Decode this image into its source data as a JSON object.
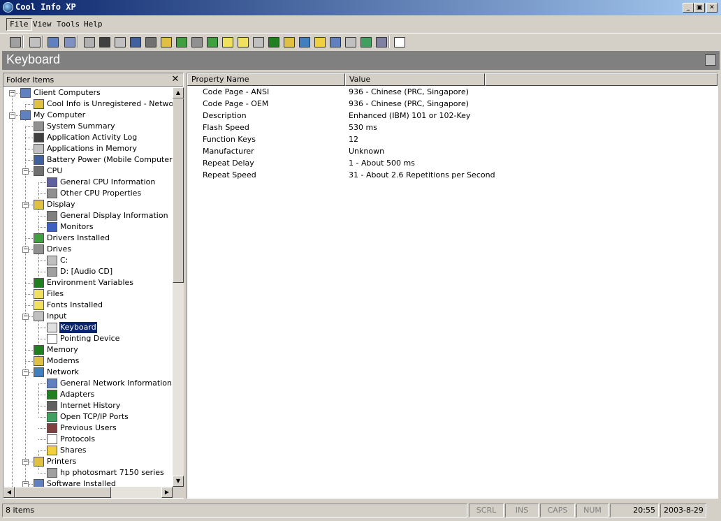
{
  "window": {
    "title": "Cool Info XP",
    "minimize": "_",
    "maximize": "▣",
    "close": "✕"
  },
  "menu": [
    {
      "label": "File"
    },
    {
      "label": "View"
    },
    {
      "label": "Tools"
    },
    {
      "label": "Help"
    }
  ],
  "toolbar": {
    "buttons": [
      {
        "icon": "printer-icon",
        "color": "#a0a0a0"
      },
      {
        "icon": "network-connect-icon",
        "color": "#c0c0c0"
      },
      {
        "icon": "properties-icon",
        "color": "#6080c0"
      },
      {
        "icon": "refresh-icon",
        "color": "#8090c0"
      },
      {
        "icon": "computer-icon",
        "color": "#b0b0b0"
      },
      {
        "icon": "memory-icon",
        "color": "#404040"
      },
      {
        "icon": "application-log-icon",
        "color": "#c0c0c0"
      },
      {
        "icon": "battery-icon",
        "color": "#4060a0"
      },
      {
        "icon": "cpu-icon",
        "color": "#707070"
      },
      {
        "icon": "display-icon",
        "color": "#e0c040"
      },
      {
        "icon": "drivers-icon",
        "color": "#40a040"
      },
      {
        "icon": "drives-icon",
        "color": "#909090"
      },
      {
        "icon": "environment-icon",
        "color": "#40a040"
      },
      {
        "icon": "files-icon",
        "color": "#f0e060"
      },
      {
        "icon": "fonts-icon",
        "color": "#f0e060"
      },
      {
        "icon": "keyboard-icon",
        "color": "#c0c0c0"
      },
      {
        "icon": "memory-chip-icon",
        "color": "#208020"
      },
      {
        "icon": "modem-icon",
        "color": "#e0c040"
      },
      {
        "icon": "network-icon",
        "color": "#4080c0"
      },
      {
        "icon": "folder-icon",
        "color": "#f0d040"
      },
      {
        "icon": "software-icon",
        "color": "#6080c0"
      },
      {
        "icon": "sound-icon",
        "color": "#c0c0c0"
      },
      {
        "icon": "tools-icon",
        "color": "#40a060"
      },
      {
        "icon": "export-icon",
        "color": "#8080a0"
      },
      {
        "icon": "help-icon",
        "color": "#ffffff"
      }
    ]
  },
  "header": {
    "title": "Keyboard"
  },
  "left": {
    "header": "Folder Items",
    "close": "✕",
    "tree": [
      {
        "label": "Client Computers",
        "level": 0,
        "exp": "minus",
        "icon": "client-computers-icon",
        "color": "#6080c0"
      },
      {
        "label": "Cool Info is Unregistered - Network V",
        "level": 1,
        "exp": "",
        "icon": "unregistered-icon",
        "color": "#e0c040"
      },
      {
        "label": "My Computer",
        "level": 0,
        "exp": "minus",
        "icon": "my-computer-icon",
        "color": "#6080c0"
      },
      {
        "label": "System Summary",
        "level": 1,
        "exp": "",
        "icon": "system-summary-icon",
        "color": "#909090"
      },
      {
        "label": "Application Activity Log",
        "level": 1,
        "exp": "",
        "icon": "activity-log-icon",
        "color": "#404040"
      },
      {
        "label": "Applications in Memory",
        "level": 1,
        "exp": "",
        "icon": "applications-icon",
        "color": "#c0c0c0"
      },
      {
        "label": "Battery Power (Mobile Computers)",
        "level": 1,
        "exp": "",
        "icon": "battery-icon",
        "color": "#4060a0"
      },
      {
        "label": "CPU",
        "level": 1,
        "exp": "minus",
        "icon": "cpu-icon",
        "color": "#707070"
      },
      {
        "label": "General CPU Information",
        "level": 2,
        "exp": "",
        "icon": "cpu-info-icon",
        "color": "#6060a0"
      },
      {
        "label": "Other CPU Properties",
        "level": 2,
        "exp": "",
        "icon": "cpu-properties-icon",
        "color": "#909090"
      },
      {
        "label": "Display",
        "level": 1,
        "exp": "minus",
        "icon": "display-icon",
        "color": "#e0c040"
      },
      {
        "label": "General Display Information",
        "level": 2,
        "exp": "",
        "icon": "display-info-icon",
        "color": "#808080"
      },
      {
        "label": "Monitors",
        "level": 2,
        "exp": "",
        "icon": "monitor-icon",
        "color": "#4060c0"
      },
      {
        "label": "Drivers Installed",
        "level": 1,
        "exp": "",
        "icon": "drivers-icon",
        "color": "#40a040"
      },
      {
        "label": "Drives",
        "level": 1,
        "exp": "minus",
        "icon": "drives-icon",
        "color": "#909090"
      },
      {
        "label": "C:",
        "level": 2,
        "exp": "",
        "icon": "hard-drive-icon",
        "color": "#c0c0c0"
      },
      {
        "label": "D: [Audio CD]",
        "level": 2,
        "exp": "",
        "icon": "cd-drive-icon",
        "color": "#a0a0a0"
      },
      {
        "label": "Environment Variables",
        "level": 1,
        "exp": "",
        "icon": "environment-icon",
        "color": "#208020"
      },
      {
        "label": "Files",
        "level": 1,
        "exp": "",
        "icon": "files-icon",
        "color": "#f0e060"
      },
      {
        "label": "Fonts Installed",
        "level": 1,
        "exp": "",
        "icon": "fonts-icon",
        "color": "#f0e060"
      },
      {
        "label": "Input",
        "level": 1,
        "exp": "minus",
        "icon": "input-icon",
        "color": "#c0c0c0"
      },
      {
        "label": "Keyboard",
        "level": 2,
        "exp": "",
        "icon": "keyboard-icon",
        "color": "#e0e0e0",
        "selected": true
      },
      {
        "label": "Pointing Device",
        "level": 2,
        "exp": "",
        "icon": "mouse-icon",
        "color": "#ffffff"
      },
      {
        "label": "Memory",
        "level": 1,
        "exp": "",
        "icon": "memory-icon",
        "color": "#208020"
      },
      {
        "label": "Modems",
        "level": 1,
        "exp": "",
        "icon": "modem-icon",
        "color": "#e0c040"
      },
      {
        "label": "Network",
        "level": 1,
        "exp": "minus",
        "icon": "network-icon",
        "color": "#4080c0"
      },
      {
        "label": "General Network Information",
        "level": 2,
        "exp": "",
        "icon": "network-info-icon",
        "color": "#6080c0"
      },
      {
        "label": "Adapters",
        "level": 2,
        "exp": "",
        "icon": "adapter-icon",
        "color": "#208020"
      },
      {
        "label": "Internet History",
        "level": 2,
        "exp": "",
        "icon": "internet-history-icon",
        "color": "#606060"
      },
      {
        "label": "Open TCP/IP Ports",
        "level": 2,
        "exp": "",
        "icon": "ports-icon",
        "color": "#40a060"
      },
      {
        "label": "Previous Users",
        "level": 2,
        "exp": "",
        "icon": "users-icon",
        "color": "#804040"
      },
      {
        "label": "Protocols",
        "level": 2,
        "exp": "",
        "icon": "protocols-icon",
        "color": "#ffffff"
      },
      {
        "label": "Shares",
        "level": 2,
        "exp": "",
        "icon": "shares-icon",
        "color": "#f0d040"
      },
      {
        "label": "Printers",
        "level": 1,
        "exp": "minus",
        "icon": "printers-icon",
        "color": "#e0c040"
      },
      {
        "label": "hp photosmart 7150 series",
        "level": 2,
        "exp": "",
        "icon": "printer-icon",
        "color": "#a0a0a0"
      },
      {
        "label": "Software Installed",
        "level": 1,
        "exp": "minus",
        "icon": "software-icon",
        "color": "#6080c0"
      }
    ]
  },
  "right": {
    "columns": [
      "Property Name",
      "Value"
    ],
    "rows": [
      [
        "Code Page - ANSI",
        "936 - Chinese (PRC, Singapore)"
      ],
      [
        "Code Page - OEM",
        "936 - Chinese (PRC, Singapore)"
      ],
      [
        "Description",
        "Enhanced (IBM) 101 or 102-Key"
      ],
      [
        "Flash Speed",
        "530 ms"
      ],
      [
        "Function Keys",
        "12"
      ],
      [
        "Manufacturer",
        "Unknown"
      ],
      [
        "Repeat Delay",
        "1 - About 500 ms"
      ],
      [
        "Repeat Speed",
        "31 - About 2.6 Repetitions per Second"
      ]
    ]
  },
  "status": {
    "items": "8 items",
    "scrl": "SCRL",
    "ins": "INS",
    "caps": "CAPS",
    "num": "NUM",
    "time": "20:55",
    "date": "2003-8-29"
  }
}
